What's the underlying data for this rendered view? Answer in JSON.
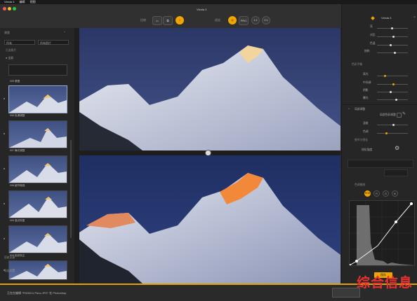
{
  "menubar": {
    "app": "Viesta 3",
    "items": [
      "编辑",
      "视图"
    ]
  },
  "titlebar": {
    "title": "Viesta 3"
  },
  "toolbar": {
    "compare_label": "比较",
    "orange_label": "",
    "pro_label": "PRO",
    "ratio_label": "2:1",
    "full_label": "1:1",
    "fit_label": "适应"
  },
  "left": {
    "section_title": "浏览",
    "filter_a": "所有",
    "filter_b": "所有照片",
    "group_label": "已选照片",
    "sort_label": "● 全部",
    "thumbs": [
      {
        "label": "005 原图"
      },
      {
        "label": "006 色调调整"
      },
      {
        "label": "007 曝光调整"
      },
      {
        "label": "008 细节增强"
      },
      {
        "label": "009 高光恢复"
      },
      {
        "label": "010 色彩校正"
      },
      {
        "label": "011 最终版本"
      }
    ],
    "bottom_a": "历史记录",
    "bottom_b": "导出设置"
  },
  "right": {
    "top_badge": "Viesta 3",
    "section1": "基础调整",
    "labels1": [
      "亮",
      "对比",
      "色温",
      "饱和"
    ],
    "section2": "色彩平衡",
    "labels2": [
      "高光",
      "中间调",
      "阴影",
      "曝光"
    ],
    "section3": "局部调整",
    "subtitle3": "局部色彩调整",
    "labels3": [
      "温度",
      "色调"
    ],
    "section4": "细节与锐化",
    "sharpen_label": "锐化强度",
    "section5": "色调曲线",
    "curve_buttons": [
      "RGB",
      "R",
      "G",
      "B"
    ],
    "save_button": "保存"
  },
  "status": {
    "text": "正在在编辑 \"P005211 Pano.JPG\" 在 Photoshop",
    "watermark": "综合信息"
  }
}
